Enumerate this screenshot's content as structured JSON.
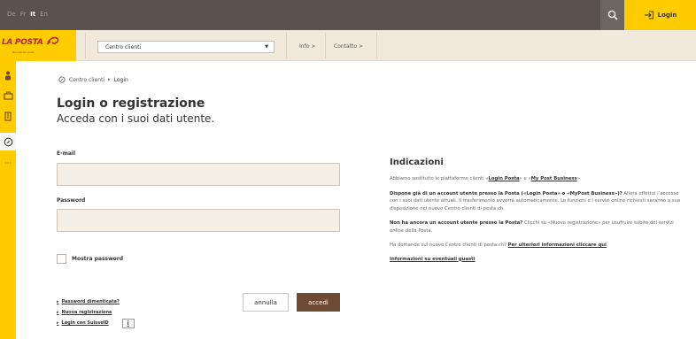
{
  "header": {
    "languages": [
      "De",
      "Fr",
      "It",
      "En"
    ],
    "active_language": "It",
    "login_label": "Login"
  },
  "nav": {
    "logo_text": "LA POSTA",
    "logo_tagline": "Benvenuto pubs",
    "select_value": "Centro clienti",
    "links": [
      "Info >",
      "Contatto >"
    ]
  },
  "rail": {
    "icons": [
      "person-icon",
      "briefcase-icon",
      "building-icon",
      "compass-icon",
      "more-icon"
    ],
    "active_index": 3
  },
  "breadcrumb": {
    "home": "Centro clienti",
    "separator": "▸",
    "current": "Login"
  },
  "page": {
    "title": "Login o registrazione",
    "subtitle": "Acceda con i suoi dati utente."
  },
  "form": {
    "email_label": "E-mail",
    "email_value": "",
    "password_label": "Password",
    "password_value": "",
    "show_password_label": "Mostra password",
    "cancel_label": "annulla",
    "submit_label": "accedi",
    "links": [
      "Password dimenticata?",
      "Nuova registrazione",
      "Login con SuisseID"
    ],
    "info_glyph": "i"
  },
  "info": {
    "title": "Indicazioni",
    "p1_a": "Abbiamo sostituito le piattaforme clienti «",
    "p1_link1": "Login Posta",
    "p1_b": "» e «",
    "p1_link2": "My Post Business",
    "p1_c": "».",
    "p2_bold": "Dispone già di un account utente presso la Posta («Login Posta» o «MyPost Business»)?",
    "p2_text": " Allora effettui l’accesso con i suoi dati utente attuali. Il trasferimento avverrà automaticamente. Le funzioni e i servizi online richiesti saranno a sua disposizione nel nuovo Centro clienti di posta.ch.",
    "p3_bold": "Non ha ancora un account utente presso la Posta?",
    "p3_text": " Clicchi su «Nuova registrazione» per usufruire subito dei servizi online della Posta.",
    "p4_text": "Ha domande sul nuovo Centro clienti di posta.ch? ",
    "p4_link": "Per ulteriori informazioni cliccare qui",
    "p4_end": ".",
    "faults_link": "Informazioni su eventuali guasti"
  },
  "colors": {
    "brand_yellow": "#ffcc00",
    "topbar": "#5b524d",
    "submit_brown": "#6e4a33",
    "logo_red": "#b22a2a"
  }
}
